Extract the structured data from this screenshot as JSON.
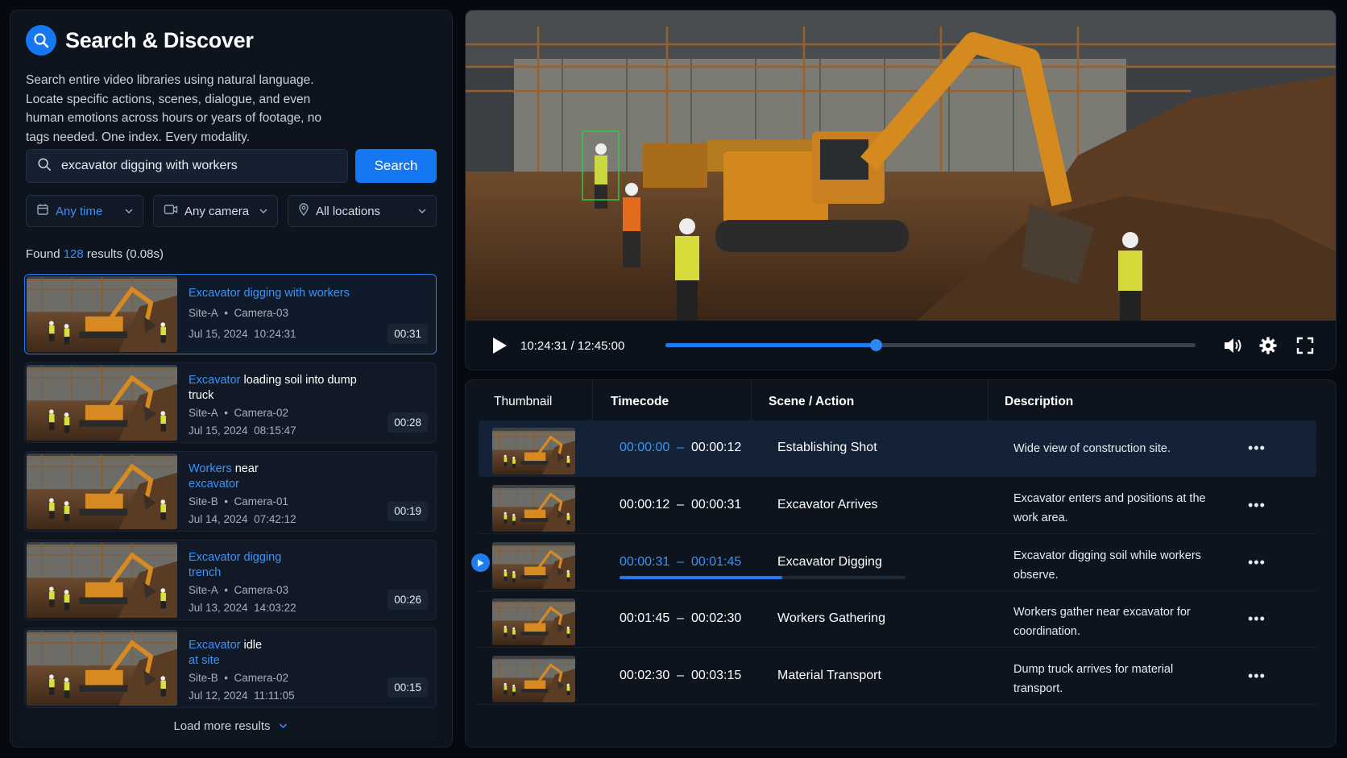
{
  "app": {
    "title": "Search & Discover",
    "description": "Search entire video libraries using natural language. Locate specific actions, scenes, dialogue, and even human emotions across hours or years of footage, no tags needed. One index. Every modality."
  },
  "search": {
    "value": "excavator digging with workers",
    "button": "Search"
  },
  "filters": [
    {
      "label": "Any time",
      "icon": "calendar-icon",
      "active": true
    },
    {
      "label": "Any camera",
      "icon": "camera-icon"
    },
    {
      "label": "All locations",
      "icon": "location-pin-icon"
    }
  ],
  "results_summary": {
    "prefix": "Found",
    "count": "128",
    "suffix": "results (0.08s)"
  },
  "results": [
    {
      "title_hl": "Excavator digging with workers",
      "title_rest": "",
      "title_hl2": "",
      "site": "Site-A",
      "camera": "Camera-03",
      "date": "Jul 15, 2024",
      "time": "10:24:31",
      "duration": "00:31"
    },
    {
      "title_hl": "Excavator",
      "title_rest": " loading soil into dump truck",
      "title_hl2": "",
      "site": "Site-A",
      "camera": "Camera-02",
      "date": "Jul 15, 2024",
      "time": "08:15:47",
      "duration": "00:28"
    },
    {
      "title_hl": "Workers",
      "title_rest": " near",
      "title_hl2": "excavator",
      "site": "Site-B",
      "camera": "Camera-01",
      "date": "Jul 14, 2024",
      "time": "07:42:12",
      "duration": "00:19"
    },
    {
      "title_hl": "Excavator digging",
      "title_rest": "",
      "title_hl2": "trench",
      "site": "Site-A",
      "camera": "Camera-03",
      "date": "Jul 13, 2024",
      "time": "14:03:22",
      "duration": "00:26"
    },
    {
      "title_hl": "Excavator",
      "title_rest": " idle",
      "title_hl2": "at site",
      "site": "Site-B",
      "camera": "Camera-02",
      "date": "Jul 12, 2024",
      "time": "11:11:05",
      "duration": "00:15"
    }
  ],
  "load_more": "Load more results",
  "player": {
    "time": "10:24:31 / 12:45:00",
    "progress": 0.397
  },
  "table": {
    "headers": [
      "Thumbnail",
      "Timecode",
      "Scene / Action",
      "Description"
    ],
    "rows": [
      {
        "start": "00:00:00",
        "end": "00:00:12",
        "scene": "Establishing Shot",
        "desc": "Wide view of construction site."
      },
      {
        "start": "00:00:12",
        "end": "00:00:31",
        "scene": "Excavator Arrives",
        "desc": "Excavator enters and positions at the work area."
      },
      {
        "start": "00:00:31",
        "end": "00:01:45",
        "scene": "Excavator Digging",
        "desc": "Excavator digging soil while workers observe."
      },
      {
        "start": "00:01:45",
        "end": "00:02:30",
        "scene": "Workers Gathering",
        "desc": "Workers gather near excavator for coordination."
      },
      {
        "start": "00:02:30",
        "end": "00:03:15",
        "scene": "Material Transport",
        "desc": "Dump truck arrives for material transport."
      }
    ],
    "active_row_progress": 0.57
  },
  "colors": {
    "accent": "#1677f2",
    "highlight": "#3b94f8",
    "panel": "#0d141d"
  }
}
